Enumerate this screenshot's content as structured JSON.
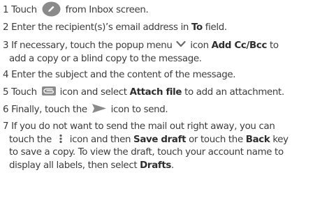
{
  "steps": [
    {
      "num": "1",
      "a": "Touch",
      "b": "from Inbox screen."
    },
    {
      "num": "2",
      "a": "Enter the recipient(s)’s email address in",
      "bold1": "To",
      "b": "field."
    },
    {
      "num": "3",
      "a": "If necessary, touch the popup menu",
      "b": "icon",
      "bold1": "Add Cc/Bcc",
      "c": "to",
      "line2": "add a copy or a blind copy to the message."
    },
    {
      "num": "4",
      "a": "Enter the subject and the content of the message."
    },
    {
      "num": "5",
      "a": "Touch",
      "b": "icon and select",
      "bold1": "Attach file",
      "c": "to add an attachment."
    },
    {
      "num": "6",
      "a": "Finally, touch the",
      "b": "icon to send."
    },
    {
      "num": "7",
      "a": "If you do not want to send the mail out right away, you can",
      "l2a": "touch the",
      "l2b": "icon and then",
      "bold1": "Save draft",
      "l2c": "or touch the",
      "bold2": "Back",
      "l2d": "key",
      "l3": "to save a copy. To view the draft, touch your account name to",
      "l4a": "display all labels, then select",
      "bold3": "Drafts",
      "l4b": "."
    }
  ],
  "icons": {
    "compose": "pencil-circle-icon",
    "popup": "chevron-down-icon",
    "attach": "attachment-icon",
    "send": "send-arrow-icon",
    "more": "more-vertical-icon"
  },
  "colors": {
    "text": "#3c3c3c",
    "icon_gray": "#8a8a8a"
  }
}
